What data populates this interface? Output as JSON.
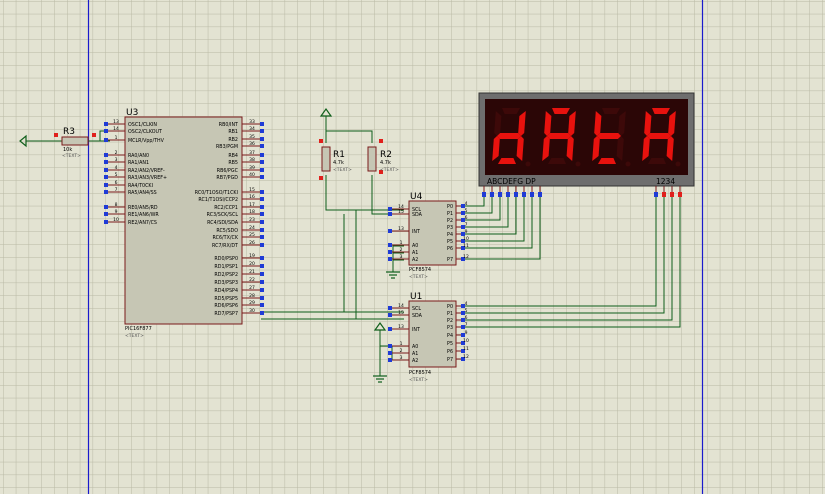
{
  "colors": {
    "background": "#e3e3d2",
    "grid": "#b9b9a4",
    "sheet_border": "#1a1acc",
    "wire": "#0e5e1a",
    "body_fill": "#c6c6b4",
    "body_stroke": "#7a1a1a",
    "pin_red": "#e0201c",
    "pin_blue": "#1f3bd6",
    "segment_on": "#e8120e",
    "display_bg": "#2b0606",
    "display_frame": "#6e6e6e",
    "text": "#000000"
  },
  "u3": {
    "ref": "U3",
    "part": "PIC16F877",
    "text": "<TEXT>",
    "left_pins": [
      {
        "num": "13",
        "name": "OSC1/CLKIN"
      },
      {
        "num": "14",
        "name": "OSC2/CLKOUT"
      },
      {
        "num": "1",
        "name": "MCLR/Vpp/THV"
      },
      {
        "num": "2",
        "name": "RA0/AN0"
      },
      {
        "num": "3",
        "name": "RA1/AN1"
      },
      {
        "num": "4",
        "name": "RA2/AN2/VREF-"
      },
      {
        "num": "5",
        "name": "RA3/AN3/VREF+"
      },
      {
        "num": "6",
        "name": "RA4/T0CKI"
      },
      {
        "num": "7",
        "name": "RA5/AN4/SS"
      },
      {
        "num": "8",
        "name": "RE0/AN5/RD"
      },
      {
        "num": "9",
        "name": "RE1/AN6/WR"
      },
      {
        "num": "10",
        "name": "RE2/AN7/CS"
      }
    ],
    "right_pins": [
      {
        "num": "33",
        "name": "RB0/INT"
      },
      {
        "num": "34",
        "name": "RB1"
      },
      {
        "num": "35",
        "name": "RB2"
      },
      {
        "num": "36",
        "name": "RB3/PGM"
      },
      {
        "num": "37",
        "name": "RB4"
      },
      {
        "num": "38",
        "name": "RB5"
      },
      {
        "num": "39",
        "name": "RB6/PGC"
      },
      {
        "num": "40",
        "name": "RB7/PGD"
      },
      {
        "num": "15",
        "name": "RC0/T1OSO/T1CKI"
      },
      {
        "num": "16",
        "name": "RC1/T1OSI/CCP2"
      },
      {
        "num": "17",
        "name": "RC2/CCP1"
      },
      {
        "num": "18",
        "name": "RC3/SCK/SCL"
      },
      {
        "num": "23",
        "name": "RC4/SDI/SDA"
      },
      {
        "num": "24",
        "name": "RC5/SDO"
      },
      {
        "num": "25",
        "name": "RC6/TX/CK"
      },
      {
        "num": "26",
        "name": "RC7/RX/DT"
      },
      {
        "num": "19",
        "name": "RD0/PSP0"
      },
      {
        "num": "20",
        "name": "RD1/PSP1"
      },
      {
        "num": "21",
        "name": "RD2/PSP2"
      },
      {
        "num": "22",
        "name": "RD3/PSP3"
      },
      {
        "num": "27",
        "name": "RD4/PSP4"
      },
      {
        "num": "28",
        "name": "RD5/PSP5"
      },
      {
        "num": "29",
        "name": "RD6/PSP6"
      },
      {
        "num": "30",
        "name": "RD7/PSP7"
      }
    ]
  },
  "r3": {
    "ref": "R3",
    "value": "10k",
    "text": "<TEXT>"
  },
  "r1": {
    "ref": "R1",
    "value": "4.7k",
    "text": "<TEXT>"
  },
  "r2": {
    "ref": "R2",
    "value": "4.7k",
    "text": "<TEXT>"
  },
  "u4": {
    "ref": "U4",
    "part": "PCF8574",
    "text": "<TEXT>",
    "left_pins": [
      {
        "num": "14",
        "name": "SCL"
      },
      {
        "num": "15",
        "name": "SDA"
      },
      {
        "num": "13",
        "name": "INT"
      },
      {
        "num": "1",
        "name": "A0"
      },
      {
        "num": "2",
        "name": "A1"
      },
      {
        "num": "3",
        "name": "A2"
      }
    ],
    "right_pins": [
      {
        "num": "4",
        "name": "P0"
      },
      {
        "num": "5",
        "name": "P1"
      },
      {
        "num": "6",
        "name": "P2"
      },
      {
        "num": "7",
        "name": "P3"
      },
      {
        "num": "9",
        "name": "P4"
      },
      {
        "num": "10",
        "name": "P5"
      },
      {
        "num": "11",
        "name": "P6"
      },
      {
        "num": "12",
        "name": "P7"
      }
    ]
  },
  "u1": {
    "ref": "U1",
    "part": "PCF8574",
    "text": "<TEXT>",
    "left_pins": [
      {
        "num": "14",
        "name": "SCL"
      },
      {
        "num": "15",
        "name": "SDA"
      },
      {
        "num": "13",
        "name": "INT"
      },
      {
        "num": "1",
        "name": "A0"
      },
      {
        "num": "2",
        "name": "A1"
      },
      {
        "num": "3",
        "name": "A2"
      }
    ],
    "right_pins": [
      {
        "num": "4",
        "name": "P0"
      },
      {
        "num": "5",
        "name": "P1"
      },
      {
        "num": "6",
        "name": "P2"
      },
      {
        "num": "7",
        "name": "P3"
      },
      {
        "num": "9",
        "name": "P4"
      },
      {
        "num": "10",
        "name": "P5"
      },
      {
        "num": "11",
        "name": "P6"
      },
      {
        "num": "12",
        "name": "P7"
      }
    ]
  },
  "display": {
    "segment_label": "ABCDEFG  DP",
    "digit_label": "1234",
    "digits": [
      {
        "char": "d",
        "segments": [
          "b",
          "c",
          "d",
          "e",
          "g"
        ]
      },
      {
        "char": "A",
        "segments": [
          "a",
          "b",
          "c",
          "e",
          "f",
          "g"
        ]
      },
      {
        "char": "t",
        "segments": [
          "d",
          "e",
          "f",
          "g"
        ]
      },
      {
        "char": "A",
        "segments": [
          "a",
          "b",
          "c",
          "e",
          "f",
          "g"
        ]
      }
    ]
  }
}
